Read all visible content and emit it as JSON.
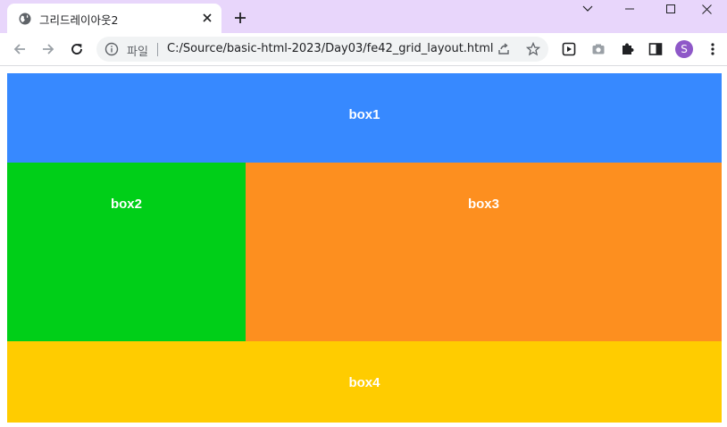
{
  "browser": {
    "tab_title": "그리드레이아웃2",
    "address_scheme_label": "파일",
    "address_url": "C:/Source/basic-html-2023/Day03/fe42_grid_layout.html",
    "profile_initial": "S",
    "icons": {
      "favicon": "globe-icon",
      "close": "close-icon",
      "new_tab": "plus-icon",
      "back": "back-arrow-icon",
      "forward": "forward-arrow-icon",
      "reload": "reload-icon",
      "info": "info-icon",
      "share": "share-icon",
      "bookmark": "star-icon"
    },
    "colors": {
      "tabstrip": "#e8d6fb",
      "avatar": "#8e58c8"
    }
  },
  "page": {
    "boxes": [
      {
        "label": "box1",
        "color": "#3789ff"
      },
      {
        "label": "box2",
        "color": "#00cf18"
      },
      {
        "label": "box3",
        "color": "#fd8f1f"
      },
      {
        "label": "box4",
        "color": "#ffcc00"
      }
    ]
  }
}
